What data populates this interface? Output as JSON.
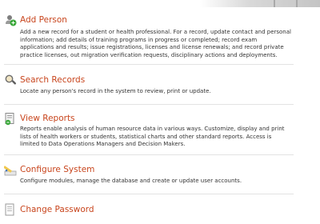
{
  "sections": [
    {
      "title": "Add Person",
      "icon": "add-person-icon",
      "description": "Add a new record for a student or health professional. For a record, update contact and personal information; add details of training programs in progress or completed; record exam applications and results; issue registrations, licenses and license renewals; and record private practice licenses, out migration verification requests, disciplinary actions and deployments."
    },
    {
      "title": "Search Records",
      "icon": "magnifier-icon",
      "description": "Locate any person's record in the system to review, print or update."
    },
    {
      "title": "View Reports",
      "icon": "report-icon",
      "description": "Reports enable analysis of human resource data in various ways. Customize, display and print lists of health workers or students, statistical charts and other standard reports. Access is limited to Data Operations Managers and Decision Makers."
    },
    {
      "title": "Configure System",
      "icon": "pencil-icon",
      "description": "Configure modules, manage the database and create or update user accounts."
    },
    {
      "title": "Change Password",
      "icon": "document-icon",
      "description": ""
    }
  ],
  "colors": {
    "title": "#c8451d",
    "text": "#333333",
    "rule": "#e3e3e3"
  }
}
